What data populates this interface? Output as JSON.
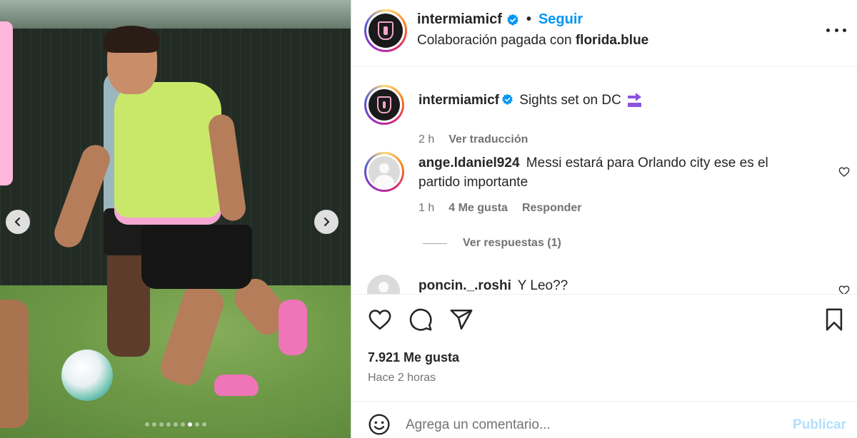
{
  "post": {
    "username": "intermiamicf",
    "follow_label": "Seguir",
    "separator": "•",
    "collab_prefix": "Colaboración pagada con",
    "collab_partner": "florida.blue",
    "more_icon": "more-horizontal-icon"
  },
  "media": {
    "carousel_total": 9,
    "carousel_active_index": 6,
    "prev_icon": "chevron-left-icon",
    "next_icon": "chevron-right-icon"
  },
  "comments": [
    {
      "username": "intermiamicf",
      "verified": true,
      "text": "Sights set on DC",
      "emoji": "soon-arrow-emoji",
      "time": "2 h",
      "translate_label": "Ver traducción"
    },
    {
      "username": "ange.ldaniel924",
      "text": "Messi estará para Orlando city ese es el partido importante",
      "time": "1 h",
      "likes_label": "4 Me gusta",
      "reply_label": "Responder",
      "view_replies_label": "Ver respuestas (1)"
    },
    {
      "username": "poncin._.roshi",
      "text": "Y Leo??"
    }
  ],
  "actions": {
    "like_icon": "heart-icon",
    "comment_icon": "comment-icon",
    "share_icon": "send-icon",
    "save_icon": "bookmark-icon",
    "likes_text": "7.921 Me gusta",
    "time_text": "Hace 2 horas"
  },
  "comment_box": {
    "placeholder": "Agrega un comentario...",
    "publish_label": "Publicar",
    "emoji_icon": "smiley-icon"
  },
  "colors": {
    "link": "#0095f6",
    "publish_disabled": "#b2dffc",
    "muted": "#737373",
    "text": "#262626"
  }
}
